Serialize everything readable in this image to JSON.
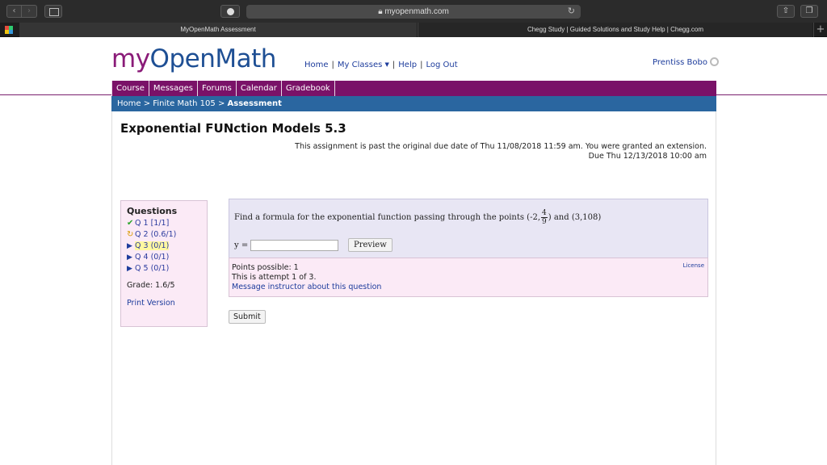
{
  "browser": {
    "url": "myopenmath.com",
    "tabs": [
      {
        "label": "MyOpenMath Assessment"
      },
      {
        "label": "Chegg Study | Guided Solutions and Study Help | Chegg.com"
      }
    ],
    "new_tab_label": "+"
  },
  "logo": {
    "my": "my",
    "rest": "OpenMath"
  },
  "topnav": {
    "home": "Home",
    "classes": "My Classes",
    "help": "Help",
    "logout": "Log Out"
  },
  "user": {
    "name": "Prentiss Bobo"
  },
  "coursenav": [
    "Course",
    "Messages",
    "Forums",
    "Calendar",
    "Gradebook"
  ],
  "breadcrumb": {
    "home": "Home",
    "course": "Finite Math 105",
    "current": "Assessment",
    "sep": ">"
  },
  "assessment": {
    "title": "Exponential FUNction Models 5.3",
    "notice_line1": "This assignment is past the original due date of Thu 11/08/2018 11:59 am. You were granted an extension.",
    "notice_line2": "Due Thu 12/13/2018 10:00 am"
  },
  "questions": {
    "heading": "Questions",
    "items": [
      {
        "label": "Q 1",
        "score": "[1/1]",
        "status": "check"
      },
      {
        "label": "Q 2",
        "score": "(0.6/1)",
        "status": "partial"
      },
      {
        "label": "Q 3",
        "score": "(0/1)",
        "status": "current"
      },
      {
        "label": "Q 4",
        "score": "(0/1)",
        "status": "arrow"
      },
      {
        "label": "Q 5",
        "score": "(0/1)",
        "status": "arrow"
      }
    ],
    "grade": "Grade: 1.6/5",
    "print": "Print Version"
  },
  "question": {
    "text_before": "Find a formula for the exponential function passing through the points (-2,",
    "frac_num": "4",
    "frac_den": "9",
    "text_after": ") and (3,108)",
    "answer_label": "y =",
    "answer_value": "",
    "preview": "Preview"
  },
  "info": {
    "points": "Points possible: 1",
    "attempt": "This is attempt 1 of 3.",
    "message": "Message instructor about this question",
    "license": "License"
  },
  "submit": "Submit",
  "colors": {
    "purple": "#7a1268",
    "blue": "#2a66a0",
    "link": "#1d3c9c"
  }
}
